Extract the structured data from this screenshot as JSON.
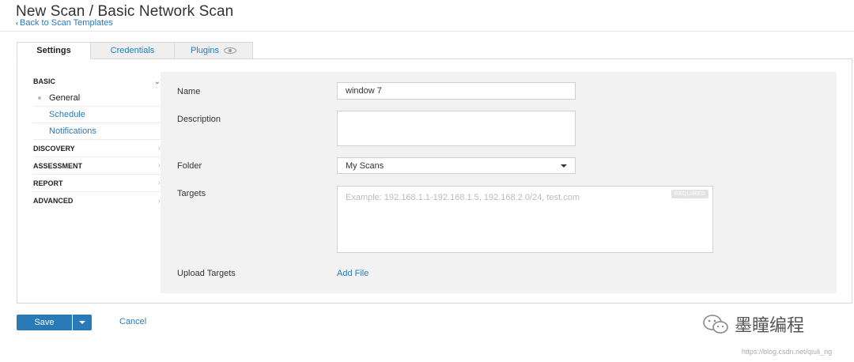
{
  "header": {
    "title": "New Scan / Basic Network Scan",
    "back_link": "Back to Scan Templates"
  },
  "tabs": [
    {
      "label": "Settings",
      "active": true
    },
    {
      "label": "Credentials",
      "active": false
    },
    {
      "label": "Plugins",
      "active": false
    }
  ],
  "sidebar": {
    "sections": [
      {
        "label": "BASIC",
        "expanded": true,
        "items": [
          "General",
          "Schedule",
          "Notifications"
        ]
      },
      {
        "label": "DISCOVERY",
        "expanded": false
      },
      {
        "label": "ASSESSMENT",
        "expanded": false
      },
      {
        "label": "REPORT",
        "expanded": false
      },
      {
        "label": "ADVANCED",
        "expanded": false
      }
    ]
  },
  "form": {
    "name_label": "Name",
    "name_value": "window 7",
    "description_label": "Description",
    "description_value": "",
    "folder_label": "Folder",
    "folder_value": "My Scans",
    "targets_label": "Targets",
    "targets_placeholder": "Example: 192.168.1.1-192.168.1.5, 192.168.2.0/24, test.com",
    "targets_badge": "REQUIRED",
    "upload_label": "Upload Targets",
    "add_file": "Add File"
  },
  "actions": {
    "save": "Save",
    "cancel": "Cancel"
  },
  "watermark": {
    "text": "墨瞳编程",
    "url": "https://blog.csdn.net/qiuli_ng"
  },
  "colors": {
    "accent": "#2a7ab8",
    "form_bg": "#f2f2f2"
  }
}
